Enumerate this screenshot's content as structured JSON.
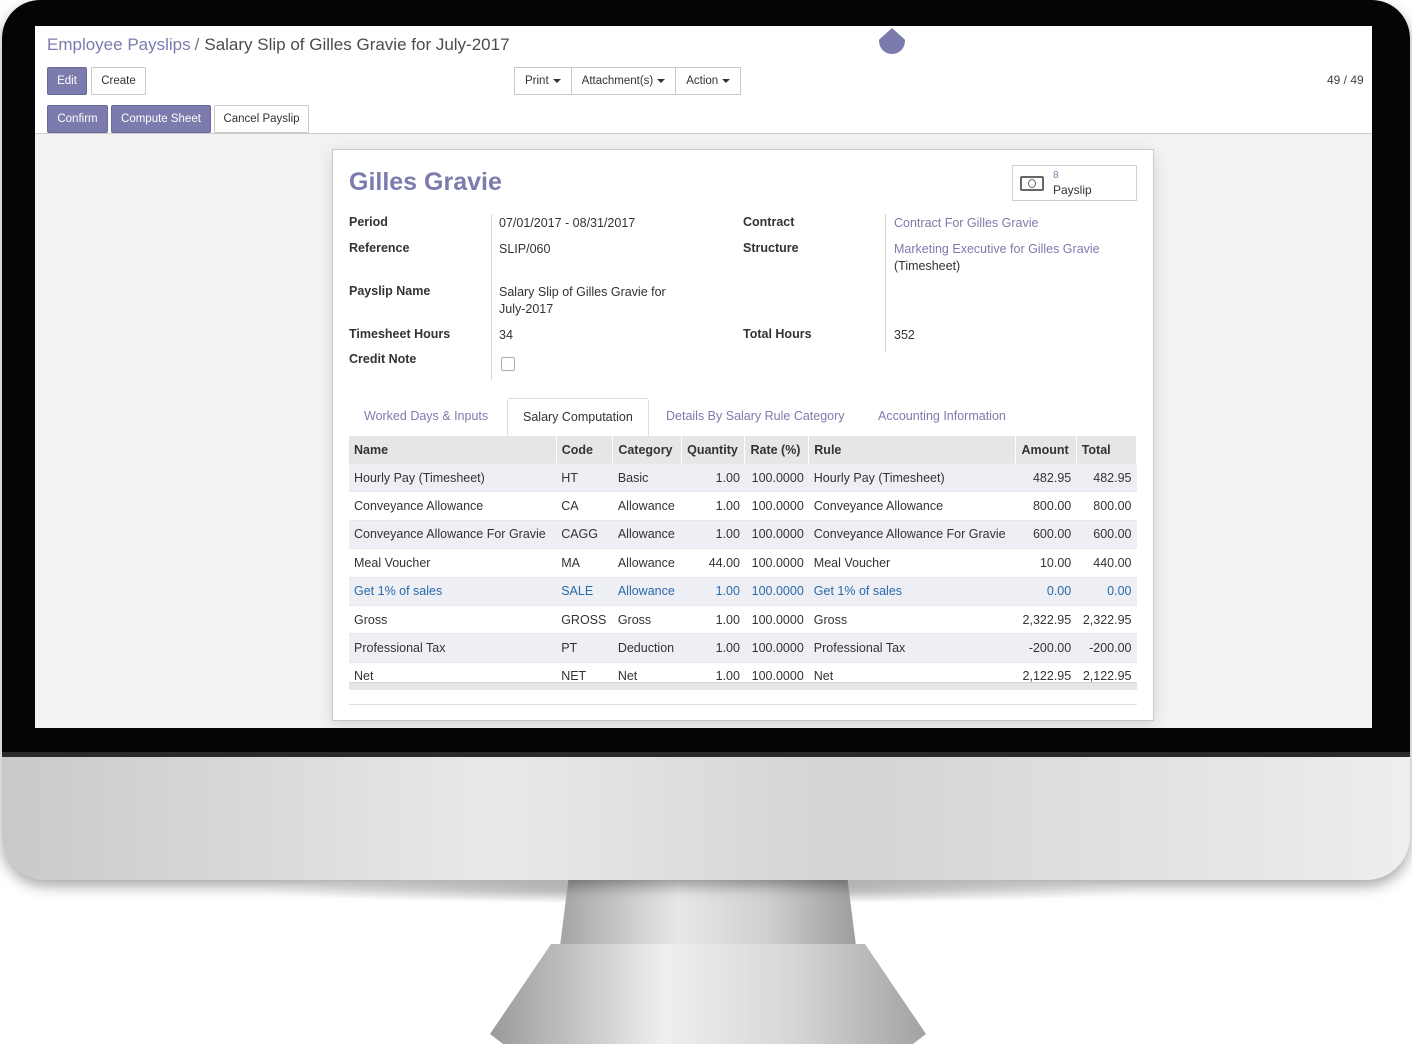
{
  "breadcrumb": {
    "parent": "Employee Payslips",
    "separator": "/",
    "current": "Salary Slip of Gilles Gravie for July-2017"
  },
  "buttons": {
    "edit": "Edit",
    "create": "Create",
    "print": "Print",
    "attachments": "Attachment(s)",
    "action": "Action"
  },
  "pager": "49 / 49",
  "status_buttons": {
    "confirm": "Confirm",
    "compute": "Compute Sheet",
    "cancel": "Cancel Payslip"
  },
  "form": {
    "employee_name": "Gilles Gravie",
    "smart_button": {
      "count": "8",
      "label": "Payslip",
      "icon": "money-icon"
    },
    "labels": {
      "period": "Period",
      "reference": "Reference",
      "payslip_name": "Payslip Name",
      "timesheet_hours": "Timesheet Hours",
      "credit_note": "Credit Note",
      "contract": "Contract",
      "structure": "Structure",
      "total_hours": "Total Hours"
    },
    "values": {
      "period": "07/01/2017 - 08/31/2017",
      "reference": "SLIP/060",
      "payslip_name_line1": "Salary Slip of Gilles Gravie for",
      "payslip_name_line2": "July-2017",
      "timesheet_hours": "34",
      "credit_note": false,
      "contract": "Contract For Gilles Gravie",
      "structure_line1": "Marketing Executive for Gilles Gravie",
      "structure_line2": "(Timesheet)",
      "total_hours": "352"
    }
  },
  "tabs": [
    "Worked Days & Inputs",
    "Salary Computation",
    "Details By Salary Rule Category",
    "Accounting Information"
  ],
  "active_tab": "Salary Computation",
  "table": {
    "headers": [
      "Name",
      "Code",
      "Category",
      "Quantity",
      "Rate (%)",
      "Rule",
      "Amount",
      "Total"
    ],
    "rows": [
      [
        "Hourly Pay (Timesheet)",
        "HT",
        "Basic",
        "1.00",
        "100.0000",
        "Hourly Pay (Timesheet)",
        "482.95",
        "482.95"
      ],
      [
        "Conveyance Allowance",
        "CA",
        "Allowance",
        "1.00",
        "100.0000",
        "Conveyance Allowance",
        "800.00",
        "800.00"
      ],
      [
        "Conveyance Allowance For Gravie",
        "CAGG",
        "Allowance",
        "1.00",
        "100.0000",
        "Conveyance Allowance For Gravie",
        "600.00",
        "600.00"
      ],
      [
        "Meal Voucher",
        "MA",
        "Allowance",
        "44.00",
        "100.0000",
        "Meal Voucher",
        "10.00",
        "440.00"
      ],
      [
        "Get 1% of sales",
        "SALE",
        "Allowance",
        "1.00",
        "100.0000",
        "Get 1% of sales",
        "0.00",
        "0.00"
      ],
      [
        "Gross",
        "GROSS",
        "Gross",
        "1.00",
        "100.0000",
        "Gross",
        "2,322.95",
        "2,322.95"
      ],
      [
        "Professional Tax",
        "PT",
        "Deduction",
        "1.00",
        "100.0000",
        "Professional Tax",
        "-200.00",
        "-200.00"
      ],
      [
        "Net",
        "NET",
        "Net",
        "1.00",
        "100.0000",
        "Net",
        "2,122.95",
        "2,122.95"
      ]
    ]
  },
  "colors": {
    "brand": "#7c7bad",
    "link_row": "#2a6aa8"
  }
}
